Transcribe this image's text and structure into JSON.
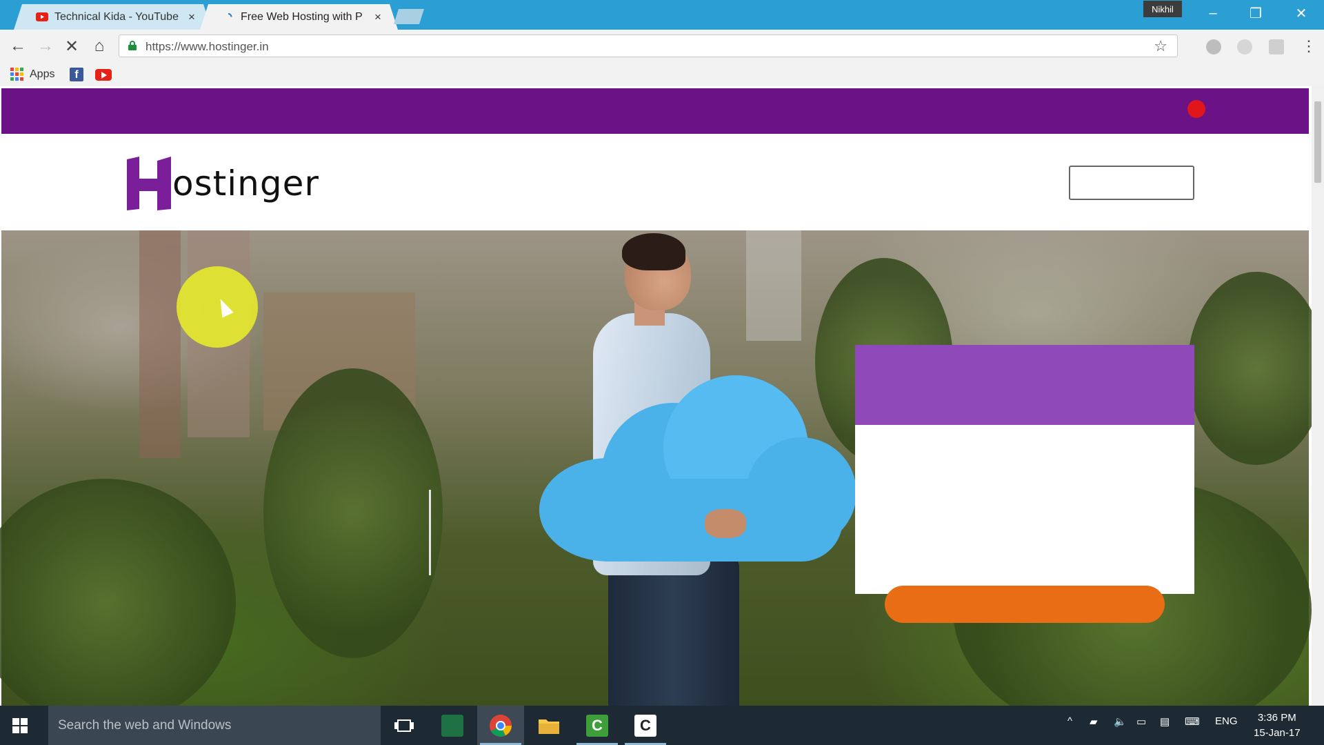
{
  "browser": {
    "tabs": [
      {
        "title": "Technical Kida - YouTube",
        "active": false
      },
      {
        "title": "Free Web Hosting with P",
        "active": true
      }
    ],
    "profile_name": "Nikhil",
    "window_controls": {
      "minimize": "–",
      "restore": "❐",
      "close": "✕"
    },
    "toolbar": {
      "back": "←",
      "forward": "→",
      "stop": "✕",
      "home": "⌂",
      "star": "☆",
      "menu": "⋮"
    },
    "address": {
      "url": "https://www.hostinger.in"
    },
    "bookmarks": {
      "apps_label": "Apps",
      "facebook_glyph": "f"
    }
  },
  "page": {
    "logo_text": "ostinger",
    "colors": {
      "topbar": "#6c1287",
      "logo_purple": "#7a1e99",
      "card_header": "#9049b8",
      "cta": "#e86d15",
      "cloud": "#4ab2e9"
    }
  },
  "taskbar": {
    "search_placeholder": "Search the web and Windows",
    "language": "ENG",
    "time": "3:36 PM",
    "date": "15-Jan-17",
    "camtasia_glyph": "C",
    "tray_chevron": "^"
  }
}
